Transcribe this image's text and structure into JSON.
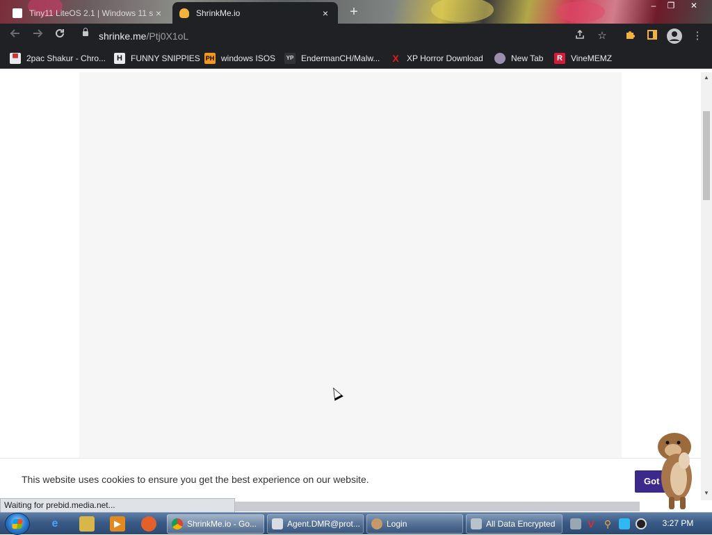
{
  "browser": {
    "tabs": [
      {
        "title": "Tiny11 LiteOS 2.1 | Windows 11 s",
        "active": false
      },
      {
        "title": "ShrinkMe.io",
        "active": true
      }
    ],
    "new_tab_glyph": "+",
    "close_glyph": "×",
    "window_controls": [
      "–",
      "❐",
      "✕"
    ],
    "omnibox": {
      "domain": "shrinke.me",
      "path": "/Ptj0X1oL"
    },
    "bookmarks": [
      {
        "label": "2pac Shakur - Chro...",
        "icon": "bus-icon"
      },
      {
        "label": "FUNNY SNIPPIES",
        "icon": "h-icon",
        "icon_text": "H"
      },
      {
        "label": "windows ISOS",
        "icon": "ph-icon",
        "icon_text": "PH"
      },
      {
        "label": "EndermanCH/Malw...",
        "icon": "yp-icon",
        "icon_text": "YP"
      },
      {
        "label": "XP Horror Download",
        "icon": "x-icon",
        "icon_text": "X"
      },
      {
        "label": "New Tab",
        "icon": "globe-icon"
      },
      {
        "label": "VineMEMZ",
        "icon": "r-icon",
        "icon_text": "R"
      }
    ]
  },
  "page": {
    "cookie_text": "This website uses cookies to ensure you get the best experience on our website.",
    "cookie_button": "Got it",
    "status_text": "Waiting for prebid.media.net..."
  },
  "taskbar": {
    "windows": [
      {
        "label": "ShrinkMe.io - Go...",
        "icon": "chrome-icon",
        "active": true
      },
      {
        "label": "Agent.DMR@prot...",
        "icon": "mail-icon",
        "active": false
      },
      {
        "label": "Login",
        "icon": "user-icon",
        "active": false
      },
      {
        "label": "All Data Encrypted",
        "icon": "lock-window-icon",
        "active": false
      }
    ],
    "clock": "3:27 PM"
  },
  "colors": {
    "chrome_dark": "#202124",
    "cookie_button": "#3b2a8c",
    "panel_bg": "#f6f6f6"
  }
}
